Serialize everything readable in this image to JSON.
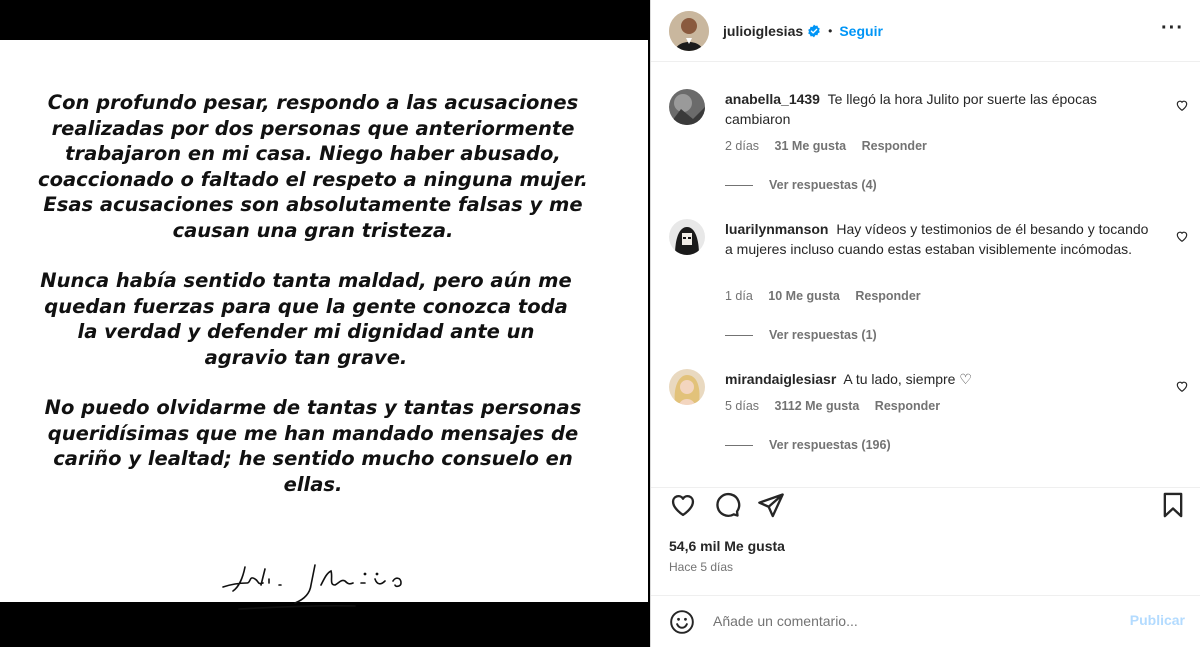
{
  "post": {
    "paragraphs": [
      "Con profundo pesar, respondo a las acusaciones realizadas por dos personas que anteriormente trabajaron en mi casa. Niego haber abusado, coaccionado o faltado el respeto a ninguna mujer. Esas acusaciones son absolutamente falsas y me causan una gran tristeza.",
      "Nunca había sentido tanta maldad, pero aún me quedan fuerzas para que la gente conozca toda la verdad y defender mi dignidad ante un agravio tan grave.",
      "No puedo olvidarme de tantas y tantas personas queridísimas que me han mandado mensajes de cariño y lealtad; he sentido mucho consuelo en ellas."
    ],
    "signature": "Julio Iglesias"
  },
  "header": {
    "username": "julioiglesias",
    "separator": "•",
    "follow_label": "Seguir",
    "more_label": "···"
  },
  "comments": [
    {
      "user": "anabella_1439",
      "text": "Te llegó la hora Julito por suerte las épocas cambiaron",
      "age": "2 días",
      "likes": "31 Me gusta",
      "reply_label": "Responder",
      "view_replies": "Ver respuestas (4)"
    },
    {
      "user": "luarilynmanson",
      "text": "Hay vídeos y testimonios de él besando y tocando a mujeres incluso cuando estas estaban visiblemente incómodas.",
      "age": "1 día",
      "likes": "10 Me gusta",
      "reply_label": "Responder",
      "view_replies": "Ver respuestas (1)"
    },
    {
      "user": "mirandaiglesiasr",
      "text": "A tu lado, siempre ♡",
      "age": "5 días",
      "likes": "3112 Me gusta",
      "reply_label": "Responder",
      "view_replies": "Ver respuestas (196)"
    }
  ],
  "stats": {
    "likes": "54,6 mil Me gusta",
    "time": "Hace 5 días"
  },
  "add_comment": {
    "placeholder": "Añade un comentario...",
    "publish_label": "Publicar"
  },
  "colors": {
    "accent": "#0095f6",
    "publish_disabled": "#b3dbff",
    "muted": "#737373"
  },
  "icons": [
    "verified-badge-icon",
    "more-options-icon",
    "heart-icon",
    "comment-icon",
    "share-icon",
    "bookmark-icon",
    "emoji-icon"
  ]
}
